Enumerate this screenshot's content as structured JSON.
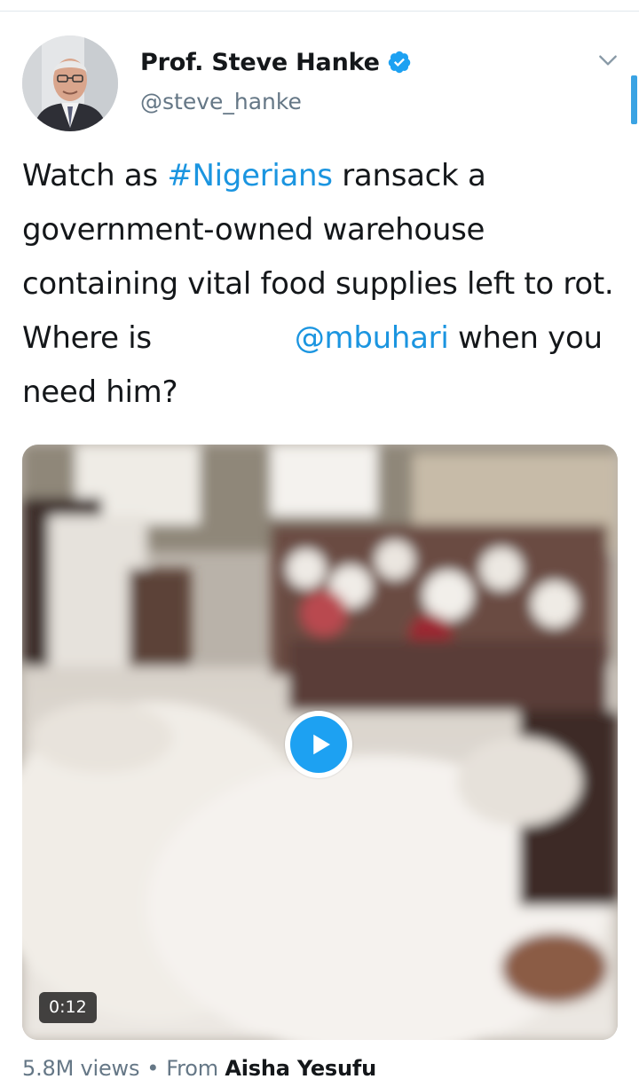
{
  "tweet": {
    "author_name": "Prof. Steve Hanke",
    "handle": "@steve_hanke",
    "verified_icon": "verified-badge-icon",
    "menu_icon": "chevron-down-icon",
    "text_part1": "Watch as ",
    "hashtag": "#Nigerians",
    "text_part2": " ransack a government-owned warehouse containing vital food supplies left to rot. Where is ",
    "mention": "@mbuhari",
    "text_part3": " when you need him?"
  },
  "media": {
    "type": "video",
    "duration": "0:12",
    "play_icon": "play-icon"
  },
  "stats": {
    "views": "5.8M views",
    "separator": "•",
    "from_label": "From",
    "source_name": "Aisha Yesufu"
  },
  "colors": {
    "link": "#1b95e0",
    "verified": "#1da1f2",
    "secondary_text": "#657786",
    "primary_text": "#14171a"
  }
}
